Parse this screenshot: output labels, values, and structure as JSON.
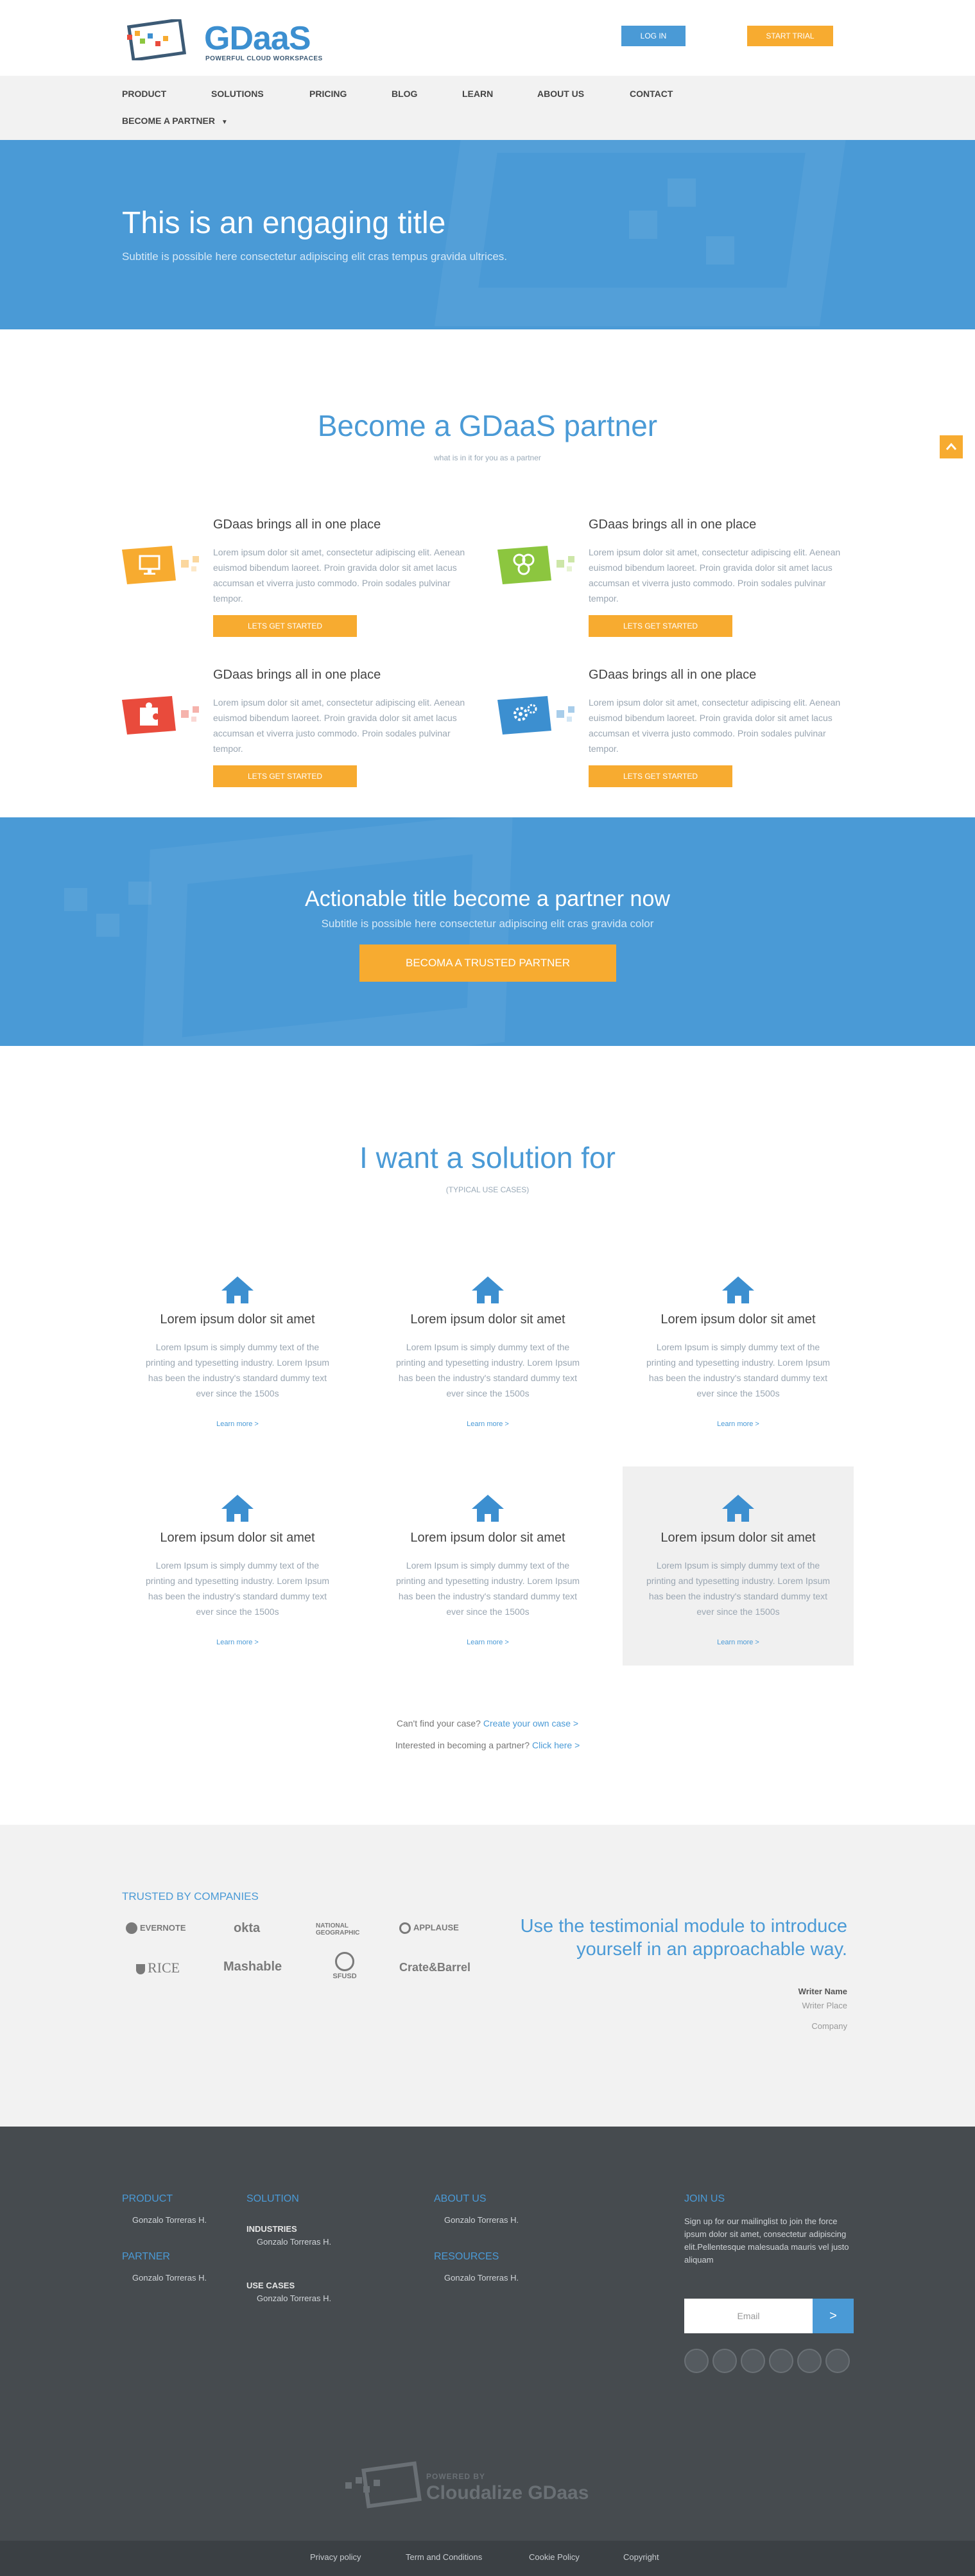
{
  "header": {
    "logo_text": "GDaaS",
    "logo_tagline": "POWERFUL CLOUD WORKSPACES",
    "login_label": "LOG IN",
    "trial_label": "START TRIAL"
  },
  "nav": {
    "items": [
      "PRODUCT",
      "SOLUTIONS",
      "PRICING",
      "BLOG",
      "LEARN",
      "ABOUT US",
      "CONTACT"
    ],
    "partner_label": "BECOME A PARTNER"
  },
  "hero": {
    "title": "This is an engaging title",
    "subtitle": "Subtitle is possible here consectetur adipiscing elit cras tempus gravida ultrices."
  },
  "partner": {
    "title": "Become a GDaaS partner",
    "subtitle": "what is in it for you as a partner",
    "features": [
      {
        "title": "GDaas brings all in one place",
        "text": "Lorem ipsum dolor sit amet, consectetur adipiscing elit. Aenean euismod bibendum laoreet. Proin gravida dolor sit amet lacus accumsan et viverra justo commodo. Proin sodales pulvinar tempor.",
        "button": "LETS GET STARTED",
        "icon": "monitor-icon",
        "color": "#f7ab30"
      },
      {
        "title": "GDaas brings all in one place",
        "text": "Lorem ipsum dolor sit amet, consectetur adipiscing elit. Aenean euismod bibendum laoreet. Proin gravida dolor sit amet lacus accumsan et viverra justo commodo. Proin sodales pulvinar tempor.",
        "button": "LETS GET STARTED",
        "icon": "cubes-icon",
        "color": "#8cc63f"
      },
      {
        "title": "GDaas brings all in one place",
        "text": "Lorem ipsum dolor sit amet, consectetur adipiscing elit. Aenean euismod bibendum laoreet. Proin gravida dolor sit amet lacus accumsan et viverra justo commodo. Proin sodales pulvinar tempor.",
        "button": "LETS GET STARTED",
        "icon": "puzzle-icon",
        "color": "#e94b3c"
      },
      {
        "title": "GDaas brings all in one place",
        "text": "Lorem ipsum dolor sit amet, consectetur adipiscing elit. Aenean euismod bibendum laoreet. Proin gravida dolor sit amet lacus accumsan et viverra justo commodo. Proin sodales pulvinar tempor.",
        "button": "LETS GET STARTED",
        "icon": "gears-icon",
        "color": "#3c8fd0"
      }
    ]
  },
  "cta": {
    "title": "Actionable title become a partner now",
    "subtitle": "Subtitle is possible here consectetur adipiscing elit cras gravida color",
    "button": "BECOMA A TRUSTED PARTNER"
  },
  "solutions": {
    "title": "I want a solution for",
    "subtitle": "(TYPICAL USE CASES)",
    "cards": [
      {
        "title": "Lorem ipsum dolor sit amet",
        "text": "Lorem Ipsum is simply dummy text of the printing and typesetting industry. Lorem Ipsum has been the industry's standard dummy text ever since the 1500s",
        "link": "Learn more >"
      },
      {
        "title": "Lorem ipsum dolor sit amet",
        "text": "Lorem Ipsum is simply dummy text of the printing and typesetting industry. Lorem Ipsum has been the industry's standard dummy text ever since the 1500s",
        "link": "Learn more >"
      },
      {
        "title": "Lorem ipsum dolor sit amet",
        "text": "Lorem Ipsum is simply dummy text of the printing and typesetting industry. Lorem Ipsum has been the industry's standard dummy text ever since the 1500s",
        "link": "Learn more >"
      },
      {
        "title": "Lorem ipsum dolor sit amet",
        "text": "Lorem Ipsum is simply dummy text of the printing and typesetting industry. Lorem Ipsum has been the industry's standard dummy text ever since the 1500s",
        "link": "Learn more >"
      },
      {
        "title": "Lorem ipsum dolor sit amet",
        "text": "Lorem Ipsum is simply dummy text of the printing and typesetting industry. Lorem Ipsum has been the industry's standard dummy text ever since the 1500s",
        "link": "Learn more >"
      },
      {
        "title": "Lorem ipsum dolor sit amet",
        "text": "Lorem Ipsum is simply dummy text of the printing and typesetting industry. Lorem Ipsum has been the industry's standard dummy text ever since the 1500s",
        "link": "Learn more >"
      }
    ],
    "question1_text": "Can't find your case?",
    "question1_link": "Create your own case >",
    "question2_text": "Interested in becoming a partner?",
    "question2_link": "Click here >"
  },
  "trusted": {
    "title": "TRUSTED BY COMPANIES",
    "logos": [
      "EVERNOTE",
      "okta",
      "NATIONAL GEOGRAPHIC",
      "APPLAUSE",
      "RICE",
      "Mashable",
      "SFUSD",
      "Crate&Barrel"
    ],
    "testimonial": "Use the testimonial module to introduce yourself in an approachable way.",
    "writer_name": "Writer Name",
    "writer_place": "Writer Place",
    "company": "Company"
  },
  "footer": {
    "product_head": "PRODUCT",
    "product_item": "Gonzalo Torreras H.",
    "partner_head": "PARTNER",
    "partner_item": "Gonzalo Torreras H.",
    "solution_head": "SOLUTION",
    "industries_head": "INDUSTRIES",
    "industries_item": "Gonzalo Torreras H.",
    "usecases_head": "USE CASES",
    "usecases_item": "Gonzalo Torreras H.",
    "about_head": "ABOUT US",
    "about_item": "Gonzalo Torreras H.",
    "resources_head": "RESOURCES",
    "resources_item": "Gonzalo Torreras H.",
    "join_head": "JOIN US",
    "join_text": "Sign up for our mailinglist to join the force ipsum dolor sit amet, consectetur adipiscing elit.Pellentesque malesuada mauris vel justo aliquam",
    "email_placeholder": "Email",
    "email_go": ">",
    "powered_by": "POWERED BY",
    "powered_name": "Cloudalize GDaas"
  },
  "bottombar": {
    "links": [
      "Privacy policy",
      "Term and Conditions",
      "Cookie Policy",
      "Copyright"
    ]
  },
  "colors": {
    "primary_blue": "#4a9ad6",
    "accent_orange": "#f7ab30",
    "footer_dark": "#464b4f"
  }
}
